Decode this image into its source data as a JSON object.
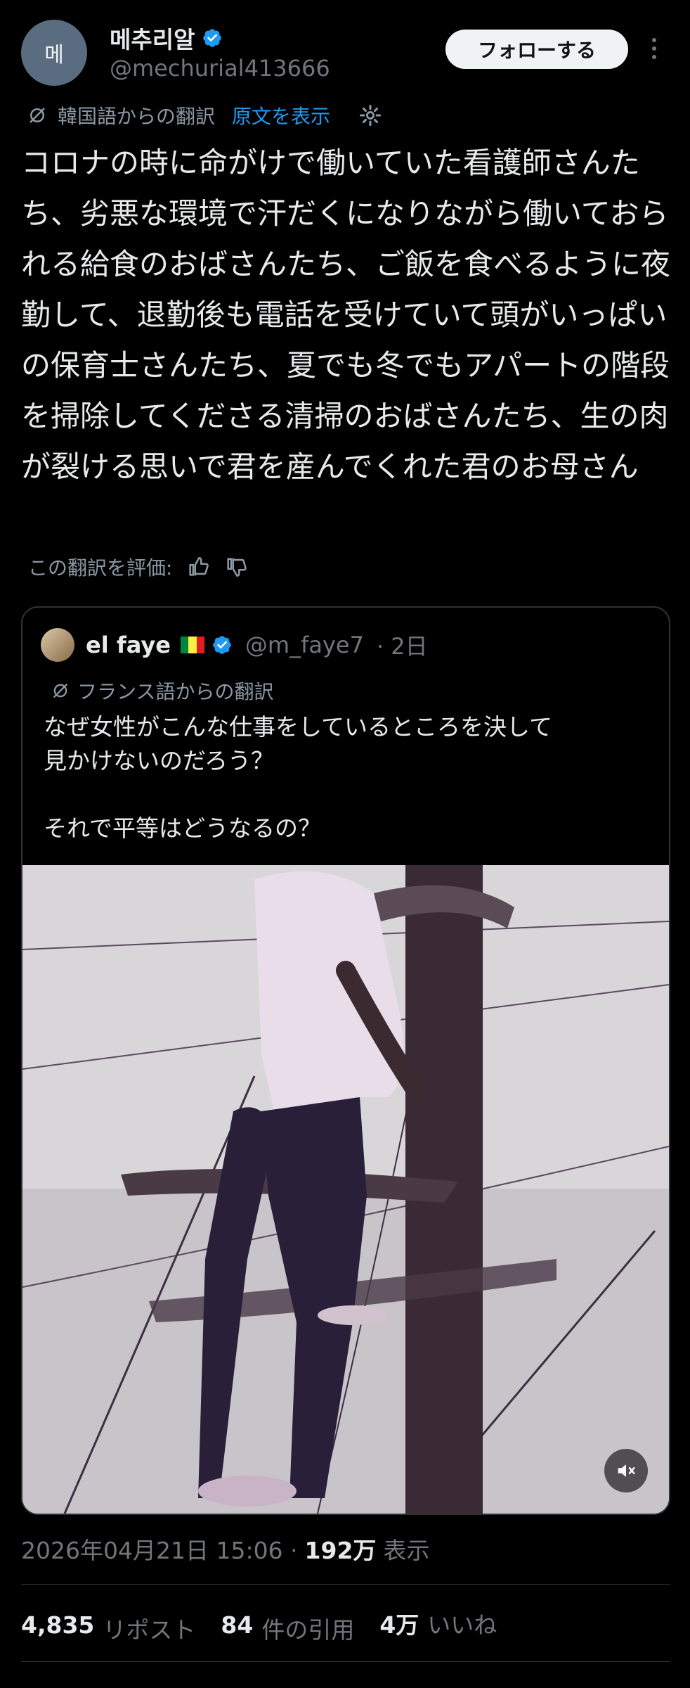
{
  "author": {
    "avatar_text": "메",
    "name": "메추리알",
    "handle": "@mechurial413666",
    "follow_label": "フォローする"
  },
  "translation": {
    "label": "韓国語からの翻訳",
    "show_original": "原文を表示"
  },
  "tweet_text": "コロナの時に命がけで働いていた看護師さんたち、劣悪な環境で汗だくになりながら働いておられる給食のおばさんたち、ご飯を食べるように夜勤して、退勤後も電話を受けていて頭がいっぱいの保育士さんたち、夏でも冬でもアパートの階段を掃除してくださる清掃のおばさんたち、生の肉が裂ける思いで君を産んでくれた君のお母さん",
  "rate_label": "この翻訳を評価:",
  "quote": {
    "name": "el faye",
    "handle": "@m_faye7",
    "time": "· 2日",
    "translation_label": "フランス語からの翻訳",
    "text_line1": "なぜ女性がこんな仕事をしているところを決して",
    "text_line2": "見かけないのだろう？",
    "text_line3": "それで平等はどうなるの？"
  },
  "meta": {
    "timestamp": "2026年04月21日 15:06 ·",
    "views_count": "192万",
    "views_label": "表示"
  },
  "stats": {
    "reposts_count": "4,835",
    "reposts_label": "リポスト",
    "quotes_count": "84",
    "quotes_label": "件の引用",
    "likes_count": "4万",
    "likes_label": "いいね"
  },
  "colors": {
    "accent": "#1d9bf0",
    "background": "#000000",
    "muted": "#71767b"
  }
}
